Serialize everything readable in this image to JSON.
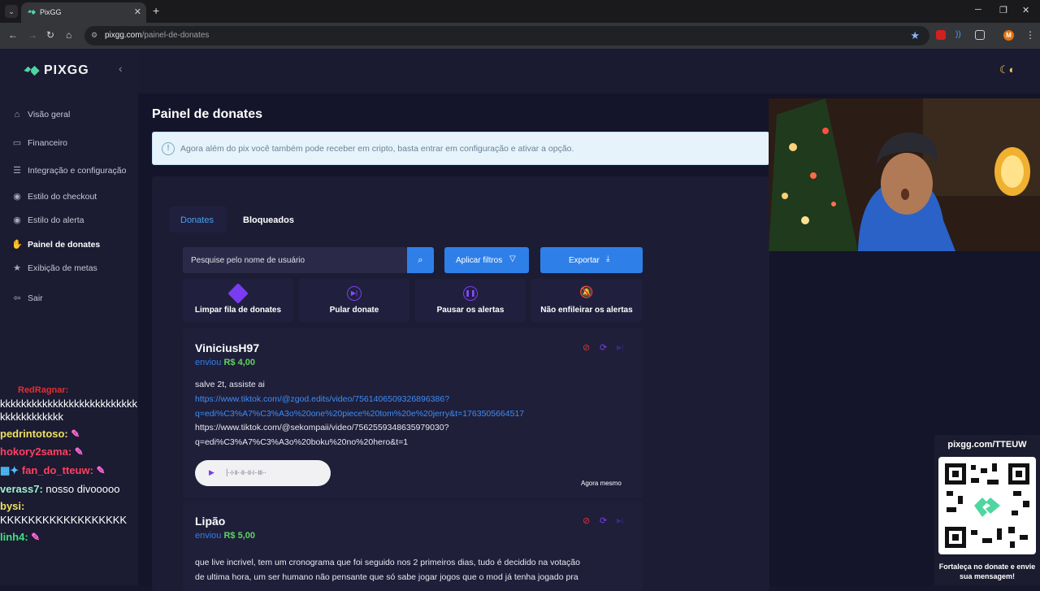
{
  "browser": {
    "tab_title": "PixGG",
    "url_host": "pixgg.com",
    "url_path": "/painel-de-donates",
    "avatar_letter": "M"
  },
  "sidebar": {
    "brand": "PIXGG",
    "items": [
      {
        "label": "Visão geral",
        "icon": "home-icon"
      },
      {
        "label": "Financeiro",
        "icon": "wallet-icon"
      },
      {
        "label": "Integração e configuração",
        "icon": "settings-icon"
      },
      {
        "label": "Estilo do checkout",
        "icon": "palette-icon"
      },
      {
        "label": "Estilo do alerta",
        "icon": "palette-icon"
      },
      {
        "label": "Painel de donates",
        "icon": "donate-hand-icon",
        "active": true
      },
      {
        "label": "Exibição de metas",
        "icon": "star-icon"
      },
      {
        "label": "Sair",
        "icon": "logout-icon"
      }
    ]
  },
  "chat": [
    {
      "user": "RedRagnar:",
      "text": "",
      "color": "#e03030"
    },
    {
      "user": "",
      "text": "kkkkkkkkkkkkkkkkkkkkkkkkkk",
      "color": "#ffffff"
    },
    {
      "user": "",
      "text": "kkkkkkkkkkkk",
      "color": "#ffffff"
    },
    {
      "user": "pedrintotoso:",
      "text": "",
      "color": "#f0e060"
    },
    {
      "user": "hokory2sama:",
      "text": "",
      "color": "#ff4060"
    },
    {
      "user": "fan_do_tteuw:",
      "text": "",
      "color": "#ff4060"
    },
    {
      "user": "verass7:",
      "text": "nosso divooooo",
      "color": "#a0f0d0"
    },
    {
      "user": "bysi:",
      "text": "",
      "color": "#f0e060"
    },
    {
      "user": "",
      "text": "KKKKKKKKKKKKKKKKKK",
      "color": "#ffffff"
    },
    {
      "user": "linh4:",
      "text": "",
      "color": "#40e080"
    }
  ],
  "main": {
    "title": "Painel de donates",
    "info_banner": "Agora além do pix você também pode receber em cripto, basta entrar em configuração e ativar a opção.",
    "tabs": [
      "Donates",
      "Bloqueados"
    ],
    "search_placeholder": "Pesquise pelo nome de usuário",
    "filter_label": "Aplicar filtros",
    "export_label": "Exportar",
    "actions": [
      {
        "label": "Limpar fila de donates",
        "icon": "eraser-icon"
      },
      {
        "label": "Pular donate",
        "icon": "skip-icon"
      },
      {
        "label": "Pausar os alertas",
        "icon": "pause-icon"
      },
      {
        "label": "Não enfileirar os alertas",
        "icon": "bell-off-icon"
      }
    ],
    "donates": [
      {
        "name": "ViniciusH97",
        "sent_label": "enviou",
        "amount": "R$ 4,00",
        "message_lines": [
          "salve 2t, assiste ai",
          "https://www.tiktok.com/@zgod.edits/video/7561406509326896386?",
          "q=edi%C3%A7%C3%A3o%20one%20piece%20tom%20e%20jerry&t=1763505664517",
          "https://www.tiktok.com/@sekompaii/video/7562559348635979030?",
          "q=edi%C3%A7%C3%A3o%20boku%20no%20hero&t=1"
        ],
        "time": "Agora mesmo"
      },
      {
        "name": "Lipão",
        "sent_label": "enviou",
        "amount": "R$ 5,00",
        "message_lines": [
          "que live incrivel, tem um cronograma que foi seguido nos 2 primeiros dias, tudo é decidido na votação",
          "de ultima hora, um ser humano não pensante que só sabe jogar jogos que o mod já tenha jogado pra"
        ]
      }
    ]
  },
  "qr": {
    "url": "pixgg.com/TTEUW",
    "cta": "Fortaleça no donate e envie sua mensagem!"
  },
  "colors": {
    "accent": "#2f7fe8",
    "amount_green": "#5fd35f",
    "action_purple": "#7a3cf0",
    "sidebar_bg": "#1b1b32"
  }
}
